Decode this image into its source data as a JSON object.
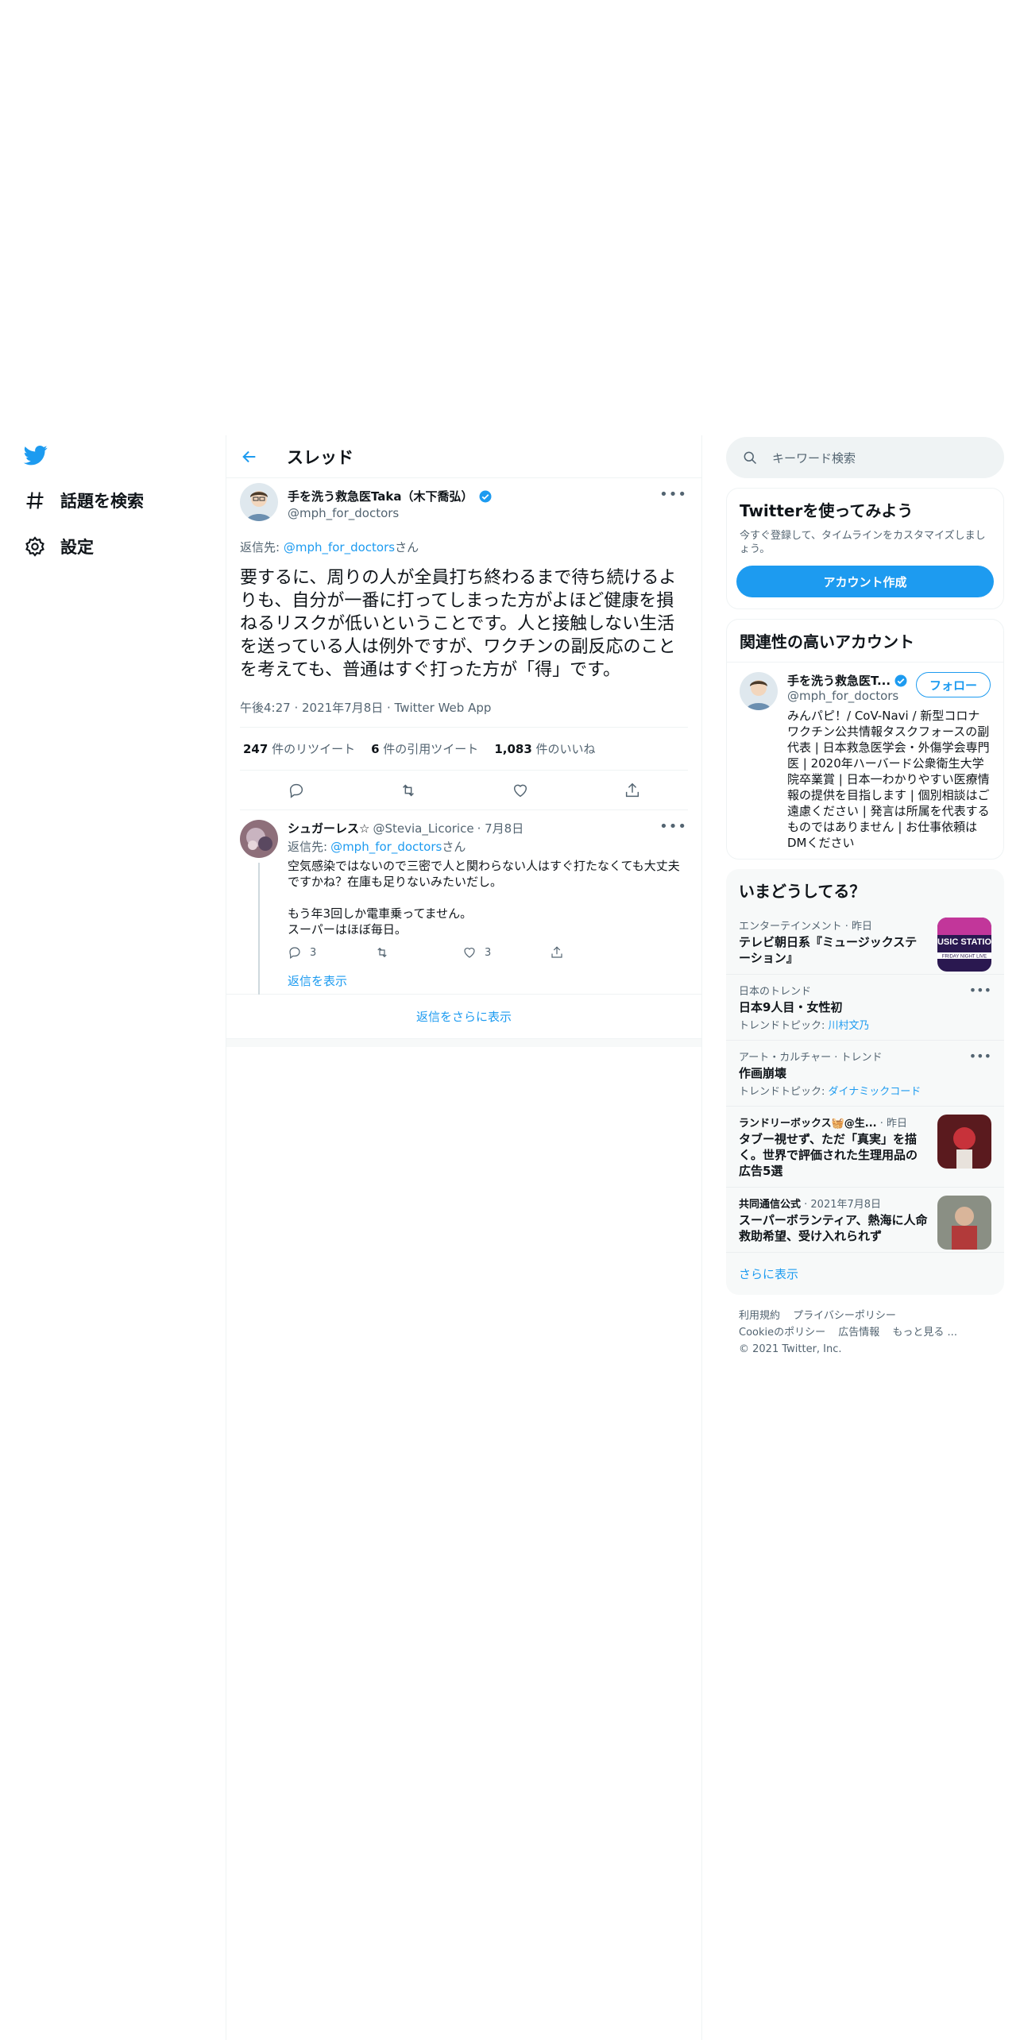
{
  "nav": {
    "items": [
      {
        "label": "話題を検索",
        "icon": "hashtag-icon"
      },
      {
        "label": "設定",
        "icon": "gear-icon"
      }
    ]
  },
  "header": {
    "title": "スレッド"
  },
  "main_tweet": {
    "author_name": "手を洗う救急医Taka（木下喬弘）",
    "handle": "@mph_for_doctors",
    "reply_to_prefix": "返信先: ",
    "reply_to_handle": "@mph_for_doctors",
    "reply_to_suffix": "さん",
    "text": "要するに、周りの人が全員打ち終わるまで待ち続けるよりも、自分が一番に打ってしまった方がよほど健康を損ねるリスクが低いということです。人と接触しない生活を送っている人は例外ですが、ワクチンの副反応のことを考えても、普通はすぐ打った方が「得」です。",
    "meta": "午後4:27 · 2021年7月8日 · Twitter Web App",
    "stats": [
      {
        "count": "247",
        "label": " 件のリツイート"
      },
      {
        "count": "6",
        "label": " 件の引用ツイート"
      },
      {
        "count": "1,083",
        "label": " 件のいいね"
      }
    ]
  },
  "reply": {
    "author_name": "シュガーレス☆",
    "handle": "@Stevia_Licorice",
    "date": "· 7月8日",
    "reply_to_prefix": "返信先: ",
    "reply_to_handle": "@mph_for_doctors",
    "reply_to_suffix": "さん",
    "text": "空気感染ではないので三密で人と関わらない人はすぐ打たなくても大丈夫ですかね？在庫も足りないみたいだし。\n\nもう年3回しか電車乗ってません。\nスーパーはほぼ毎日。",
    "reply_count": "3",
    "like_count": "3",
    "show_replies": "返信を表示"
  },
  "more_replies": "返信をさらに表示",
  "right": {
    "search_placeholder": "キーワード検索",
    "signup": {
      "title": "Twitterを使ってみよう",
      "subtitle": "今すぐ登録して、タイムラインをカスタマイズしましょう。",
      "button": "アカウント作成"
    },
    "related": {
      "title": "関連性の高いアカウント",
      "name": "手を洗う救急医T...",
      "handle": "@mph_for_doctors",
      "follow": "フォロー",
      "bio": "みんパピ！/ CoV-Navi / 新型コロナワクチン公共情報タスクフォースの副代表 | 日本救急医学会・外傷学会専門医 | 2020年ハーバード公衆衛生大学院卒業賞 | 日本一わかりやすい医療情報の提供を目指します | 個別相談はご遠慮ください | 発言は所属を代表するものではありません | お仕事依頼はDMください"
    },
    "trends": {
      "title": "いまどうしてる？",
      "items": [
        {
          "cat": "エンターテインメント · 昨日",
          "name": "テレビ朝日系『ミュージックステーション』",
          "sub": "",
          "sub_link": ""
        },
        {
          "cat": "日本のトレンド",
          "name": "日本9人目・女性初",
          "sub": "トレンドトピック: ",
          "sub_link": "川村文乃"
        },
        {
          "cat": "アート・カルチャー · トレンド",
          "name": "作画崩壊",
          "sub": "トレンドトピック: ",
          "sub_link": "ダイナミックコード"
        },
        {
          "cat_name": "ランドリーボックス🧺@生...",
          "cat": " · 昨日",
          "name": "タブー視せず、ただ「真実」を描く。世界で評価された生理用品の広告5選",
          "sub": "",
          "sub_link": ""
        },
        {
          "cat_name": "共同通信公式",
          "cat": " · 2021年7月8日",
          "name": "スーパーボランティア、熱海に人命救助希望、受け入れられず",
          "sub": "",
          "sub_link": ""
        }
      ],
      "show_more": "さらに表示",
      "music_station_text": "USIC STATIO",
      "music_station_sub": "FRIDAY NIGHT LIVE"
    },
    "footer": {
      "links": [
        "利用規約",
        "プライバシーポリシー",
        "Cookieのポリシー",
        "広告情報",
        "もっと見る ..."
      ],
      "copyright": "© 2021 Twitter, Inc."
    }
  },
  "colors": {
    "accent": "#1d9bf0",
    "text": "#0f1419",
    "muted": "#536471"
  }
}
